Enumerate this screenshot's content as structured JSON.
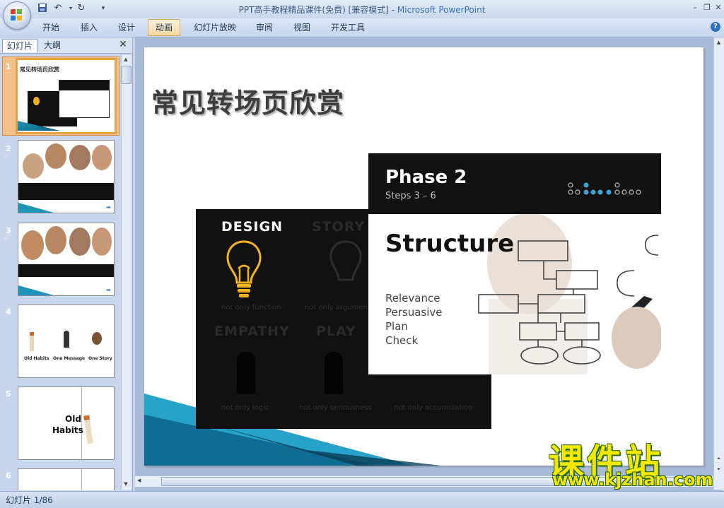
{
  "window": {
    "title": "PPT高手教程精品课件(免费) [兼容模式]",
    "app_name": "Microsoft PowerPoint",
    "title_separator": " - "
  },
  "quick_access": {
    "save_icon": "save-icon",
    "undo_icon": "undo-icon",
    "redo_icon": "redo-icon",
    "customize_icon": "dropdown-icon"
  },
  "ribbon": {
    "tabs": [
      {
        "label": "开始"
      },
      {
        "label": "插入"
      },
      {
        "label": "设计"
      },
      {
        "label": "动画",
        "active": true
      },
      {
        "label": "幻灯片放映"
      },
      {
        "label": "审阅"
      },
      {
        "label": "视图"
      },
      {
        "label": "开发工具"
      }
    ]
  },
  "left_pane": {
    "tab_slides": "幻灯片",
    "tab_outline": "大纲",
    "slides": [
      {
        "number": "1",
        "title": "常见转场页欣赏",
        "selected": true
      },
      {
        "number": "2",
        "has_animation": true
      },
      {
        "number": "3",
        "has_animation": true
      },
      {
        "number": "4",
        "labels": [
          "Old Habits",
          "One Message",
          "One Story"
        ]
      },
      {
        "number": "5",
        "text_line1": "Old",
        "text_line2": "Habits"
      },
      {
        "number": "6"
      }
    ]
  },
  "slide": {
    "title": "常见转场页欣赏",
    "quad": {
      "cells": [
        {
          "label": "DESIGN",
          "sub": "not only function",
          "color": "#ffffff"
        },
        {
          "label": "STORY",
          "sub": "not only argument",
          "color": "#2a2a2a"
        },
        {
          "label": "EMPATHY",
          "sub": "not only logic",
          "color": "#2a2a2a"
        },
        {
          "label": "PLAY",
          "sub": "not only seriousness",
          "color": "#2a2a2a"
        },
        {
          "label": "",
          "sub": "not only accumulation",
          "color": "#2a2a2a"
        }
      ],
      "accent": "#f0b41e"
    },
    "phase": {
      "title": "Phase 2",
      "steps": "Steps 3 – 6",
      "heading": "Structure",
      "items": [
        "Relevance",
        "Persuasive",
        "Plan",
        "Check"
      ],
      "dot_accent": "#3fa3d9"
    }
  },
  "status_bar": {
    "text": "幻灯片 1/86"
  },
  "watermark": {
    "brand": "课件站",
    "url": "www.kjzhan.com"
  }
}
